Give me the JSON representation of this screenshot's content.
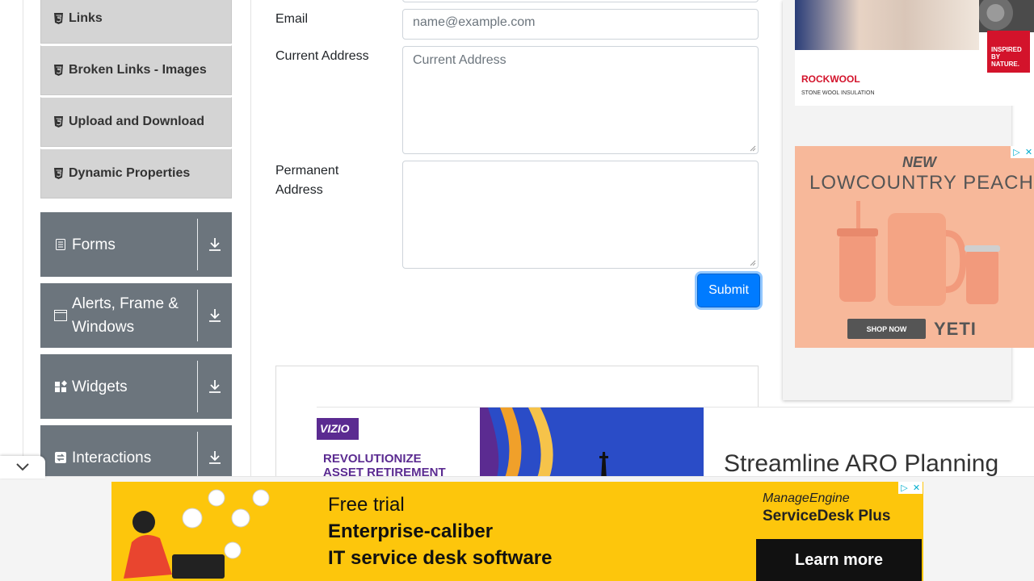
{
  "sidebar": {
    "sub_items": [
      {
        "label": "Links"
      },
      {
        "label": "Broken Links - Images"
      },
      {
        "label": "Upload and Download"
      },
      {
        "label": "Dynamic Properties"
      }
    ],
    "groups": [
      {
        "label": "Forms",
        "icon": "form-icon"
      },
      {
        "label": "Alerts, Frame & Windows",
        "icon": "window-icon"
      },
      {
        "label": "Widgets",
        "icon": "widgets-icon"
      },
      {
        "label": "Interactions",
        "icon": "interactions-icon"
      }
    ]
  },
  "form": {
    "email_label": "Email",
    "email_placeholder": "name@example.com",
    "current_address_label": "Current Address",
    "current_address_placeholder": "Current Address",
    "permanent_address_label_1": "Permanent",
    "permanent_address_label_2": "Address",
    "submit_label": "Submit"
  },
  "ads": {
    "vizio": {
      "logo": "VIZIO",
      "headline_1": "REVOLUTIONIZE",
      "headline_2": "ASSET RETIREMENT",
      "title": "Streamline ARO Planning"
    },
    "rockwool": {
      "badge_1": "INSPIRED",
      "badge_2": "BY",
      "badge_3": "NATURE.",
      "brand": "ROCKWOOL",
      "tagline": "STONE WOOL INSULATION"
    },
    "yeti": {
      "new": "NEW",
      "title": "LOWCOUNTRY PEACH",
      "cta": "SHOP NOW",
      "brand": "YETI"
    },
    "manageengine": {
      "line1": "Free trial",
      "line2": "Enterprise-caliber",
      "line3": "IT service desk software",
      "brand_top": "ManageEngine",
      "brand_bottom": "ServiceDesk Plus",
      "cta": "Learn more"
    }
  },
  "colors": {
    "primary": "#007bff",
    "sidebar_group": "#6c757d",
    "sidebar_sub": "#d4d4d4"
  }
}
